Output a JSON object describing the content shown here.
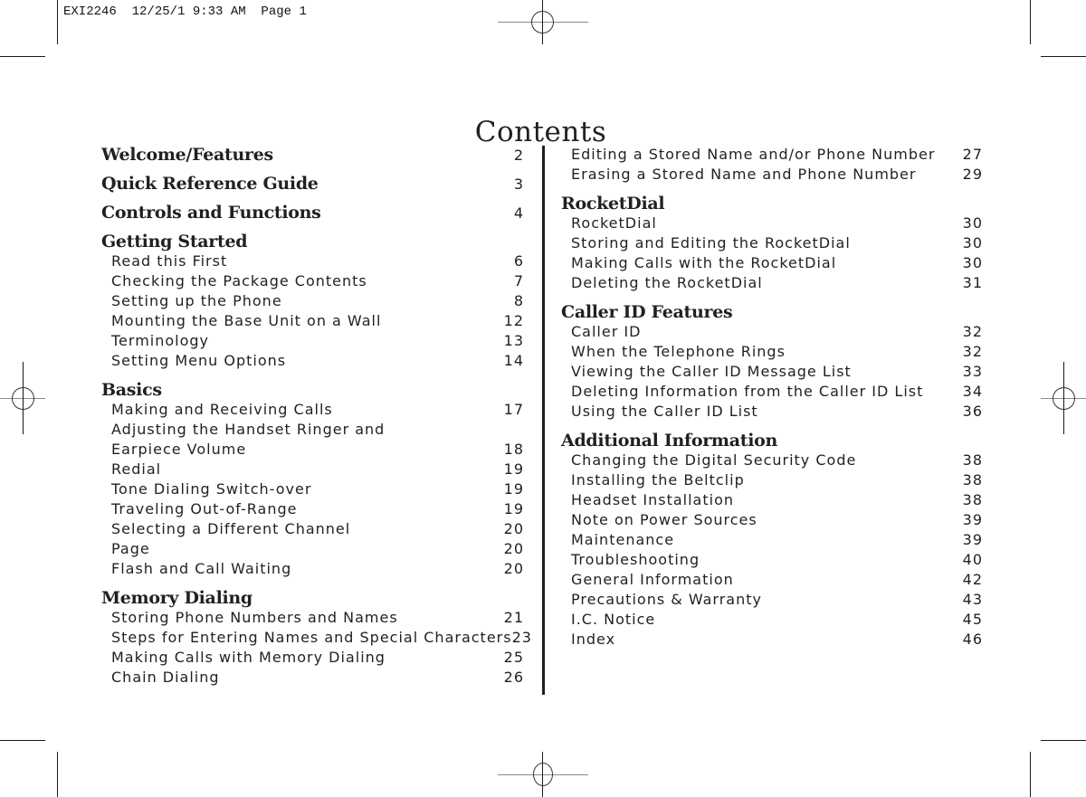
{
  "print_slug": "EXI2246  12/25/1 9:33 AM  Page 1",
  "page_title": "Contents",
  "left_column": [
    {
      "type": "heading",
      "label": "Welcome/Features",
      "page": "2"
    },
    {
      "type": "heading",
      "label": "Quick Reference Guide",
      "page": "3"
    },
    {
      "type": "heading",
      "label": "Controls and Functions",
      "page": "4"
    },
    {
      "type": "heading",
      "label": "Getting Started",
      "page": ""
    },
    {
      "type": "item",
      "label": "Read this First",
      "page": "6"
    },
    {
      "type": "item",
      "label": "Checking the Package Contents",
      "page": "7"
    },
    {
      "type": "item",
      "label": "Setting up the Phone",
      "page": "8"
    },
    {
      "type": "item",
      "label": "Mounting the Base Unit on a Wall",
      "page": "12"
    },
    {
      "type": "item",
      "label": "Terminology",
      "page": "13"
    },
    {
      "type": "item",
      "label": "Setting Menu Options",
      "page": "14"
    },
    {
      "type": "heading",
      "label": "Basics",
      "page": ""
    },
    {
      "type": "item",
      "label": "Making and Receiving Calls",
      "page": "17"
    },
    {
      "type": "item",
      "label": "Adjusting the Handset Ringer and",
      "page": ""
    },
    {
      "type": "item",
      "label": "Earpiece Volume",
      "page": "18"
    },
    {
      "type": "item",
      "label": "Redial",
      "page": "19"
    },
    {
      "type": "item",
      "label": "Tone Dialing Switch-over",
      "page": "19"
    },
    {
      "type": "item",
      "label": "Traveling Out-of-Range",
      "page": "19"
    },
    {
      "type": "item",
      "label": "Selecting a Different Channel",
      "page": "20"
    },
    {
      "type": "item",
      "label": "Page",
      "page": "20"
    },
    {
      "type": "item",
      "label": "Flash and Call Waiting",
      "page": "20"
    },
    {
      "type": "heading",
      "label": "Memory Dialing",
      "page": ""
    },
    {
      "type": "item",
      "label": "Storing Phone Numbers and Names",
      "page": "21"
    },
    {
      "type": "item",
      "label": "Steps for Entering Names and Special Characters",
      "page": "23"
    },
    {
      "type": "item",
      "label": "Making Calls with Memory Dialing",
      "page": "25"
    },
    {
      "type": "item",
      "label": "Chain Dialing",
      "page": "26"
    }
  ],
  "right_column": [
    {
      "type": "item",
      "label": "Editing a Stored Name and/or Phone Number",
      "page": "27"
    },
    {
      "type": "item",
      "label": "Erasing a Stored Name and Phone Number",
      "page": "29"
    },
    {
      "type": "heading",
      "label": "RocketDial",
      "page": ""
    },
    {
      "type": "item",
      "label": "RocketDial",
      "page": "30"
    },
    {
      "type": "item",
      "label": "Storing and Editing the RocketDial",
      "page": "30"
    },
    {
      "type": "item",
      "label": "Making Calls with the RocketDial",
      "page": "30"
    },
    {
      "type": "item",
      "label": "Deleting the RocketDial",
      "page": "31"
    },
    {
      "type": "heading",
      "label": "Caller ID Features",
      "page": ""
    },
    {
      "type": "item",
      "label": "Caller ID",
      "page": "32"
    },
    {
      "type": "item",
      "label": "When the Telephone Rings",
      "page": "32"
    },
    {
      "type": "item",
      "label": "Viewing the Caller ID Message List",
      "page": "33"
    },
    {
      "type": "item",
      "label": "Deleting Information from the Caller ID List",
      "page": "34"
    },
    {
      "type": "item",
      "label": "Using the Caller ID List",
      "page": "36"
    },
    {
      "type": "heading",
      "label": "Additional Information",
      "page": ""
    },
    {
      "type": "item",
      "label": "Changing the Digital Security Code",
      "page": "38"
    },
    {
      "type": "item",
      "label": "Installing the Beltclip",
      "page": "38"
    },
    {
      "type": "item",
      "label": "Headset Installation",
      "page": "38"
    },
    {
      "type": "item",
      "label": "Note on Power Sources",
      "page": "39"
    },
    {
      "type": "item",
      "label": "Maintenance",
      "page": "39"
    },
    {
      "type": "item",
      "label": "Troubleshooting",
      "page": "40"
    },
    {
      "type": "item",
      "label": "General Information",
      "page": "42"
    },
    {
      "type": "item",
      "label": "Precautions & Warranty",
      "page": "43"
    },
    {
      "type": "item",
      "label": "I.C. Notice",
      "page": "45"
    },
    {
      "type": "item",
      "label": "Index",
      "page": "46"
    }
  ]
}
